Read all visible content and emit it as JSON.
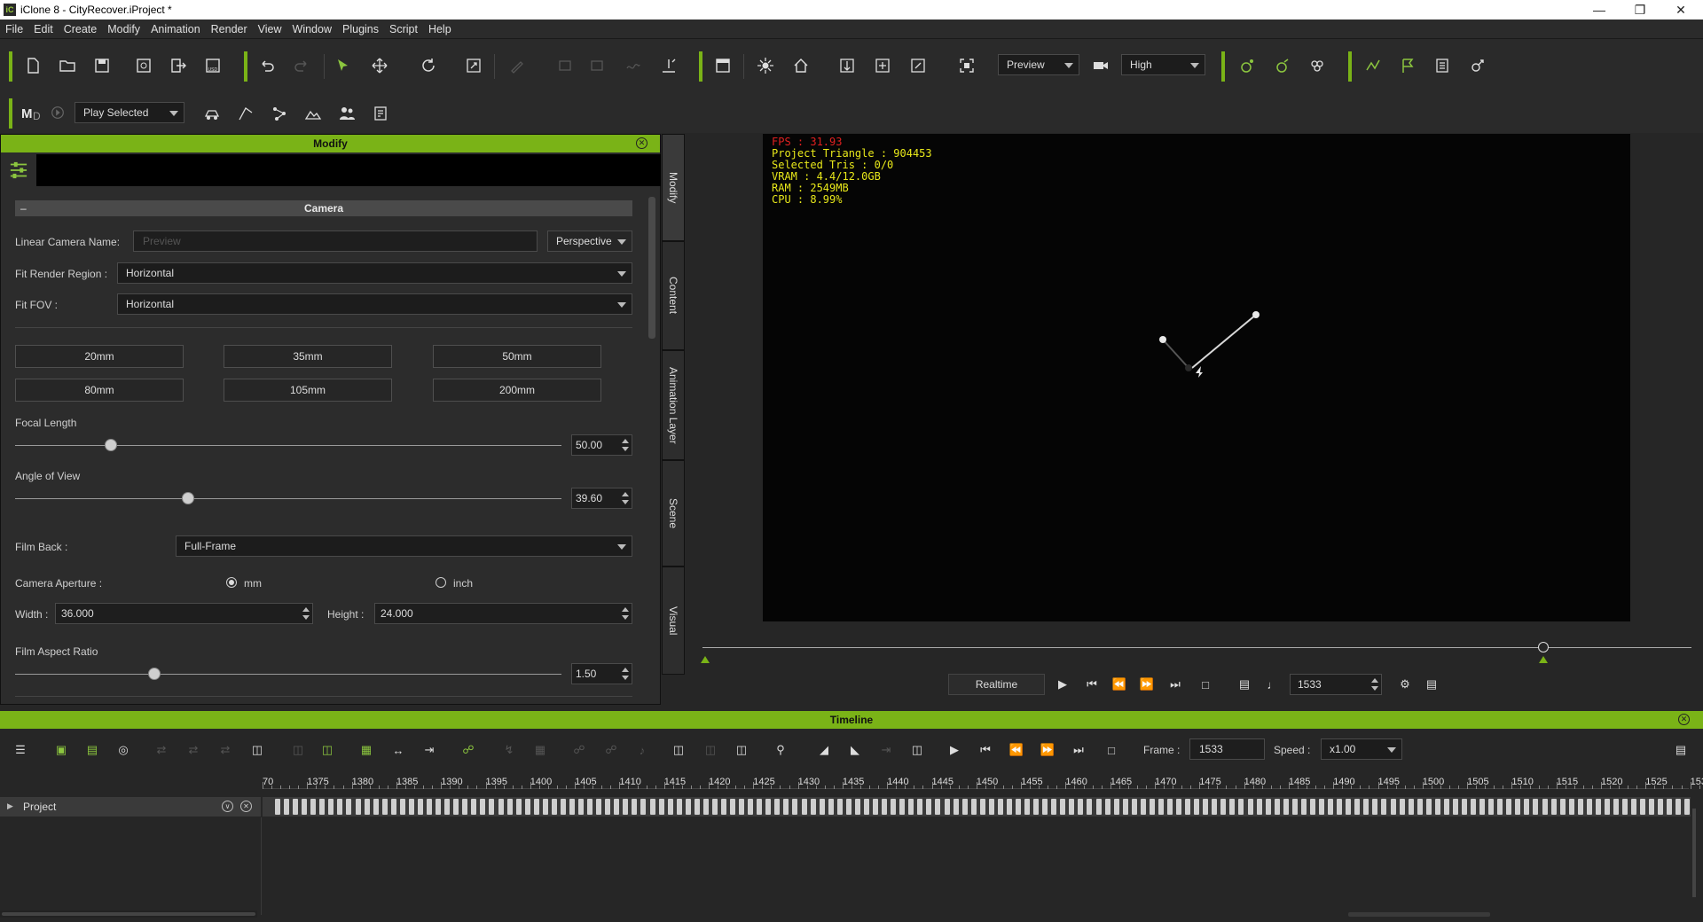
{
  "window": {
    "title": "iClone 8 - CityRecover.iProject *",
    "app_icon": "iclone-icon",
    "controls": [
      "minimize",
      "maximize",
      "close"
    ]
  },
  "menubar": {
    "items": [
      "File",
      "Edit",
      "Create",
      "Modify",
      "Animation",
      "Render",
      "View",
      "Window",
      "Plugins",
      "Script",
      "Help"
    ]
  },
  "toolbar2": {
    "play_mode": "Play Selected"
  },
  "toolbar1": {
    "preview_mode": "Preview",
    "quality": "High"
  },
  "modify_panel": {
    "title": "Modify",
    "section": "Camera",
    "linear_camera_name_label": "Linear Camera Name:",
    "linear_camera_name_placeholder": "Preview",
    "projection": "Perspective",
    "fit_render_region_label": "Fit Render Region :",
    "fit_render_region_value": "Horizontal",
    "fit_fov_label": "Fit FOV :",
    "fit_fov_value": "Horizontal",
    "presets": [
      "20mm",
      "35mm",
      "50mm",
      "80mm",
      "105mm",
      "200mm"
    ],
    "focal_length_label": "Focal Length",
    "focal_length_value": "50.00",
    "angle_of_view_label": "Angle of View",
    "angle_of_view_value": "39.60",
    "film_back_label": "Film Back :",
    "film_back_value": "Full-Frame",
    "camera_aperture_label": "Camera Aperture :",
    "aperture_unit_mm": "mm",
    "aperture_unit_inch": "inch",
    "width_label": "Width :",
    "width_value": "36.000",
    "height_label": "Height :",
    "height_value": "24.000",
    "film_aspect_ratio_label": "Film Aspect Ratio",
    "film_aspect_ratio_value": "1.50",
    "tabs": [
      "Modify",
      "Content",
      "Animation Layer",
      "Scene",
      "Visual"
    ]
  },
  "viewport": {
    "stats": {
      "fps": "FPS : 31.93",
      "project_triangle": "Project Triangle : 904453",
      "selected_tris": "Selected Tris : 0/0",
      "vram": "VRAM : 4.4/12.0GB",
      "ram": "RAM : 2549MB",
      "cpu": "CPU : 8.99%"
    }
  },
  "playback": {
    "realtime_label": "Realtime",
    "frame": "1533"
  },
  "timeline": {
    "title": "Timeline",
    "frame_label": "Frame :",
    "frame_value": "1533",
    "speed_label": "Speed :",
    "speed_value": "x1.00",
    "track_name": "Project",
    "ruler": [
      "70",
      "1375",
      "1380",
      "1385",
      "1390",
      "1395",
      "1400",
      "1405",
      "1410",
      "1415",
      "1420",
      "1425",
      "1430",
      "1435",
      "1440",
      "1445",
      "1450",
      "1455",
      "1460",
      "1465",
      "1470",
      "1475",
      "1480",
      "1485",
      "1490",
      "1495",
      "1500",
      "1505",
      "1510",
      "1515",
      "1520",
      "1525",
      "153("
    ]
  },
  "colors": {
    "accent": "#7ab317",
    "stats_text": "#e8e81a",
    "fps_text": "#e02020"
  }
}
